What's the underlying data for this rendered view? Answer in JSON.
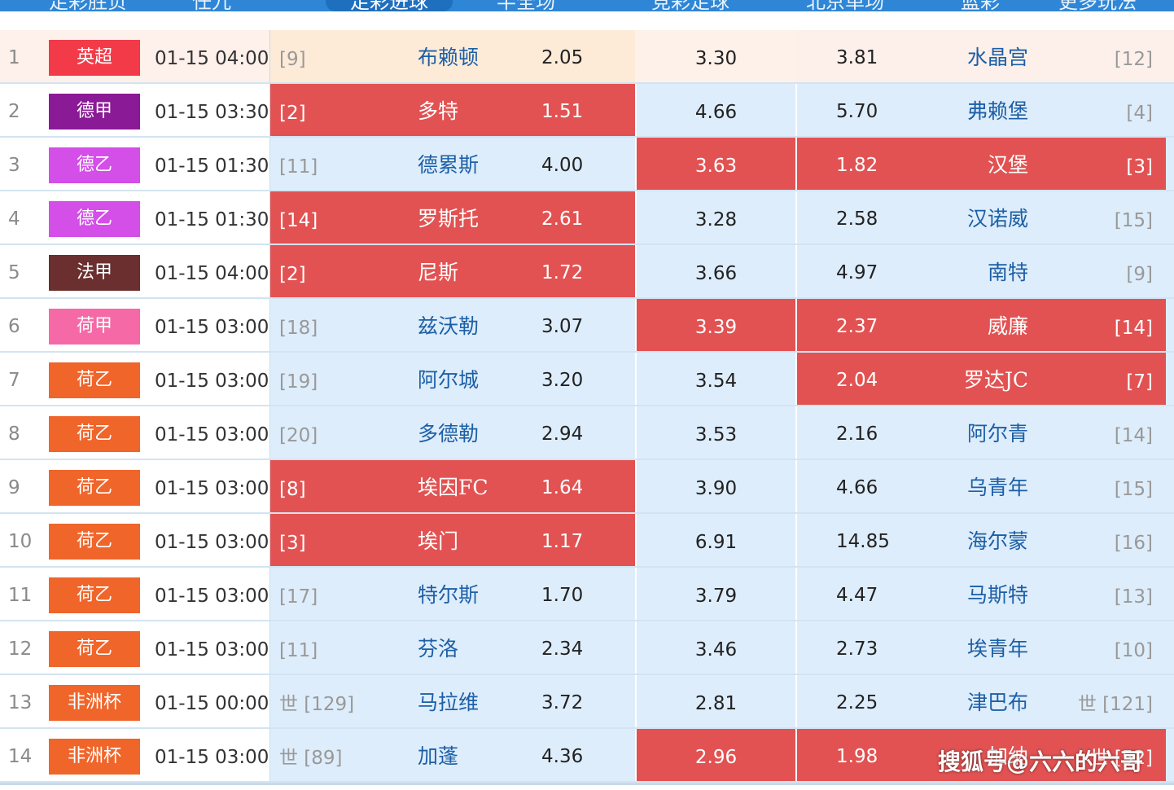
{
  "nav": {
    "tabs": [
      {
        "label": "足彩胜负",
        "active": false
      },
      {
        "label": "任九",
        "active": false
      },
      {
        "label": "足彩进球",
        "active": true
      },
      {
        "label": "半全场",
        "active": false
      },
      {
        "label": "竞彩足球",
        "active": false
      },
      {
        "label": "北京单场",
        "active": false
      },
      {
        "label": "篮彩",
        "active": false
      },
      {
        "label": "更多玩法",
        "active": false
      }
    ]
  },
  "colors": {
    "highlight": "#e25252",
    "cell": "#deedfb",
    "team_text": "#1c5fa6"
  },
  "rows": [
    {
      "num": "1",
      "league": "英超",
      "league_color": "#f23a48",
      "time": "01-15 04:00",
      "home_rank": "[9]",
      "home": "布赖顿",
      "home_odd": "2.05",
      "draw": "3.30",
      "away_odd": "3.81",
      "away": "水晶宫",
      "away_rank": "[12]",
      "hl_home": false,
      "hl_draw": false,
      "hl_away": false
    },
    {
      "num": "2",
      "league": "德甲",
      "league_color": "#8b1a96",
      "time": "01-15 03:30",
      "home_rank": "[2]",
      "home": "多特",
      "home_odd": "1.51",
      "draw": "4.66",
      "away_odd": "5.70",
      "away": "弗赖堡",
      "away_rank": "[4]",
      "hl_home": true,
      "hl_draw": false,
      "hl_away": false
    },
    {
      "num": "3",
      "league": "德乙",
      "league_color": "#d44ee8",
      "time": "01-15 01:30",
      "home_rank": "[11]",
      "home": "德累斯",
      "home_odd": "4.00",
      "draw": "3.63",
      "away_odd": "1.82",
      "away": "汉堡",
      "away_rank": "[3]",
      "hl_home": false,
      "hl_draw": true,
      "hl_away": true
    },
    {
      "num": "4",
      "league": "德乙",
      "league_color": "#d44ee8",
      "time": "01-15 01:30",
      "home_rank": "[14]",
      "home": "罗斯托",
      "home_odd": "2.61",
      "draw": "3.28",
      "away_odd": "2.58",
      "away": "汉诺威",
      "away_rank": "[15]",
      "hl_home": true,
      "hl_draw": false,
      "hl_away": false
    },
    {
      "num": "5",
      "league": "法甲",
      "league_color": "#6b2f2f",
      "time": "01-15 04:00",
      "home_rank": "[2]",
      "home": "尼斯",
      "home_odd": "1.72",
      "draw": "3.66",
      "away_odd": "4.97",
      "away": "南特",
      "away_rank": "[9]",
      "hl_home": true,
      "hl_draw": false,
      "hl_away": false
    },
    {
      "num": "6",
      "league": "荷甲",
      "league_color": "#f56aa6",
      "time": "01-15 03:00",
      "home_rank": "[18]",
      "home": "兹沃勒",
      "home_odd": "3.07",
      "draw": "3.39",
      "away_odd": "2.37",
      "away": "威廉",
      "away_rank": "[14]",
      "hl_home": false,
      "hl_draw": true,
      "hl_away": true
    },
    {
      "num": "7",
      "league": "荷乙",
      "league_color": "#f0652a",
      "time": "01-15 03:00",
      "home_rank": "[19]",
      "home": "阿尔城",
      "home_odd": "3.20",
      "draw": "3.54",
      "away_odd": "2.04",
      "away": "罗达JC",
      "away_rank": "[7]",
      "hl_home": false,
      "hl_draw": false,
      "hl_away": true
    },
    {
      "num": "8",
      "league": "荷乙",
      "league_color": "#f0652a",
      "time": "01-15 03:00",
      "home_rank": "[20]",
      "home": "多德勒",
      "home_odd": "2.94",
      "draw": "3.53",
      "away_odd": "2.16",
      "away": "阿尔青",
      "away_rank": "[14]",
      "hl_home": false,
      "hl_draw": false,
      "hl_away": false
    },
    {
      "num": "9",
      "league": "荷乙",
      "league_color": "#f0652a",
      "time": "01-15 03:00",
      "home_rank": "[8]",
      "home": "埃因FC",
      "home_odd": "1.64",
      "draw": "3.90",
      "away_odd": "4.66",
      "away": "乌青年",
      "away_rank": "[15]",
      "hl_home": true,
      "hl_draw": false,
      "hl_away": false
    },
    {
      "num": "10",
      "league": "荷乙",
      "league_color": "#f0652a",
      "time": "01-15 03:00",
      "home_rank": "[3]",
      "home": "埃门",
      "home_odd": "1.17",
      "draw": "6.91",
      "away_odd": "14.85",
      "away": "海尔蒙",
      "away_rank": "[16]",
      "hl_home": true,
      "hl_draw": false,
      "hl_away": false
    },
    {
      "num": "11",
      "league": "荷乙",
      "league_color": "#f0652a",
      "time": "01-15 03:00",
      "home_rank": "[17]",
      "home": "特尔斯",
      "home_odd": "1.70",
      "draw": "3.79",
      "away_odd": "4.47",
      "away": "马斯特",
      "away_rank": "[13]",
      "hl_home": false,
      "hl_draw": false,
      "hl_away": false
    },
    {
      "num": "12",
      "league": "荷乙",
      "league_color": "#f0652a",
      "time": "01-15 03:00",
      "home_rank": "[11]",
      "home": "芬洛",
      "home_odd": "2.34",
      "draw": "3.46",
      "away_odd": "2.73",
      "away": "埃青年",
      "away_rank": "[10]",
      "hl_home": false,
      "hl_draw": false,
      "hl_away": false
    },
    {
      "num": "13",
      "league": "非洲杯",
      "league_color": "#f0652a",
      "time": "01-15 00:00",
      "home_rank": "世 [129]",
      "home": "马拉维",
      "home_odd": "3.72",
      "draw": "2.81",
      "away_odd": "2.25",
      "away": "津巴布",
      "away_rank": "世 [121]",
      "hl_home": false,
      "hl_draw": false,
      "hl_away": false
    },
    {
      "num": "14",
      "league": "非洲杯",
      "league_color": "#f0652a",
      "time": "01-15 03:00",
      "home_rank": "世 [89]",
      "home": "加蓬",
      "home_odd": "4.36",
      "draw": "2.96",
      "away_odd": "1.98",
      "away": "加纳",
      "away_rank": "世 [52]",
      "hl_home": false,
      "hl_draw": true,
      "hl_away": true
    }
  ],
  "watermark": "搜狐号@六六的六哥"
}
